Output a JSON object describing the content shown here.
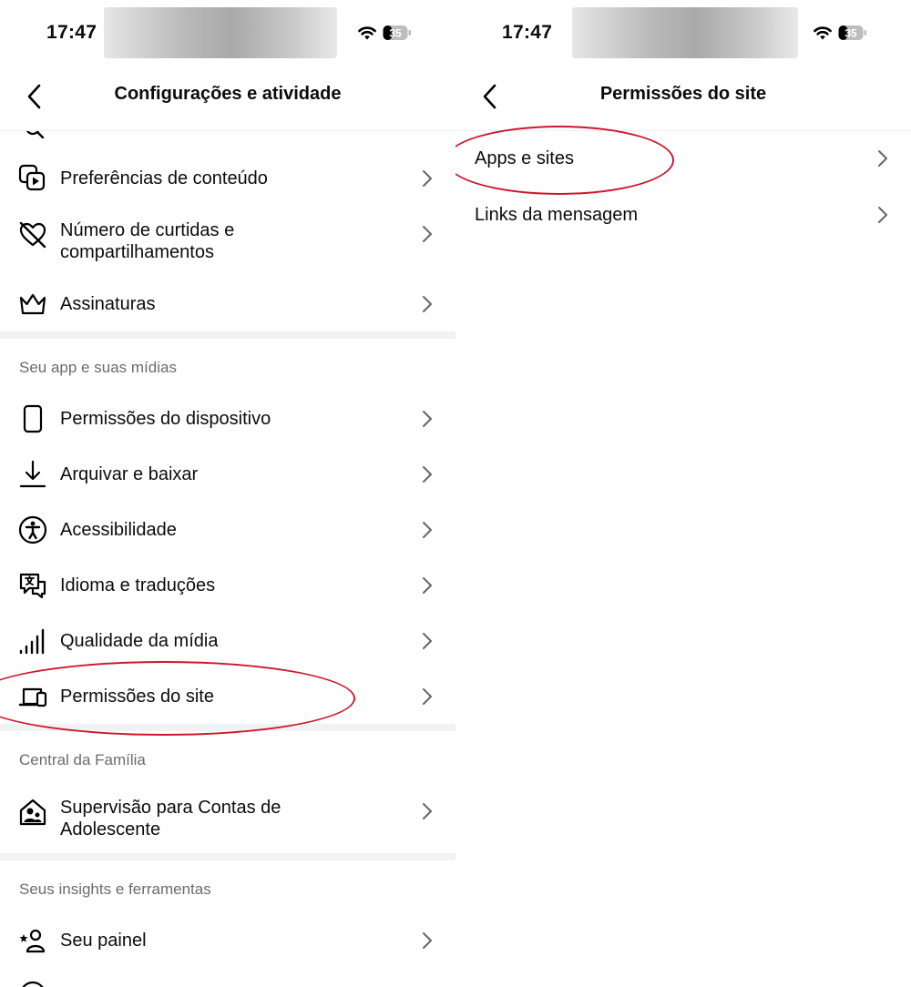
{
  "status_bar": {
    "time": "17:47",
    "battery": "35"
  },
  "left": {
    "title": "Configurações e atividade",
    "items_top": [
      {
        "label": "Preferências de conteúdo",
        "icon": "content-preferences-icon"
      },
      {
        "label": "Número de curtidas e compartilhamentos",
        "line1": "Número de curtidas e",
        "line2": "compartilhamentos",
        "icon": "heart-slash-icon"
      },
      {
        "label": "Assinaturas",
        "icon": "crown-icon"
      }
    ],
    "section_app": "Seu app e suas mídias",
    "items_app": [
      {
        "label": "Permissões do dispositivo",
        "icon": "phone-icon"
      },
      {
        "label": "Arquivar e baixar",
        "icon": "download-icon"
      },
      {
        "label": "Acessibilidade",
        "icon": "accessibility-icon"
      },
      {
        "label": "Idioma e traduções",
        "icon": "translate-icon"
      },
      {
        "label": "Qualidade da mídia",
        "icon": "signal-bars-icon"
      },
      {
        "label": "Permissões do site",
        "icon": "devices-icon"
      }
    ],
    "section_family": "Central da Família",
    "items_family": [
      {
        "label": "Supervisão para Contas de Adolescente",
        "line1": "Supervisão para Contas de",
        "line2": "Adolescente",
        "icon": "family-home-icon"
      }
    ],
    "section_insights": "Seus insights e ferramentas",
    "items_insights": [
      {
        "label": "Seu painel",
        "icon": "star-person-icon"
      }
    ]
  },
  "right": {
    "title": "Permissões do site",
    "items": [
      {
        "label": "Apps e sites"
      },
      {
        "label": "Links da mensagem"
      }
    ]
  },
  "colors": {
    "highlight_circle": "#d0162b",
    "divider": "#f1f2f4",
    "section_text": "#6b6b6b"
  }
}
